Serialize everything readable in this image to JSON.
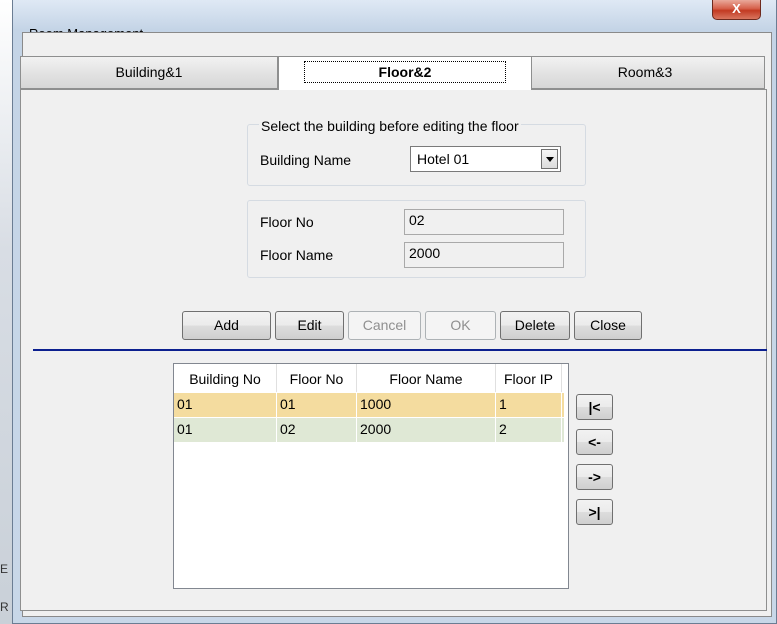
{
  "window": {
    "title": "Room Management",
    "close_label": "X"
  },
  "tabs": [
    {
      "label": "Building&1"
    },
    {
      "label": "Floor&2"
    },
    {
      "label": "Room&3"
    }
  ],
  "building_group": {
    "caption": "Select the building before editing the floor",
    "building_name_label": "Building Name",
    "building_name_value": "Hotel 01"
  },
  "floor_group": {
    "floor_no_label": "Floor No",
    "floor_no_value": "02",
    "floor_name_label": "Floor Name",
    "floor_name_value": "2000"
  },
  "buttons": {
    "add": "Add",
    "edit": "Edit",
    "cancel": "Cancel",
    "ok": "OK",
    "delete": "Delete",
    "close": "Close"
  },
  "grid": {
    "columns": [
      "Building No",
      "Floor No",
      "Floor Name",
      "Floor IP"
    ],
    "rows": [
      {
        "cells": [
          "01",
          "01",
          "1000",
          "1"
        ],
        "color": "#f4dc9f"
      },
      {
        "cells": [
          "01",
          "02",
          "2000",
          "2"
        ],
        "color": "#dfe8d5"
      }
    ]
  },
  "nav": {
    "first": "|<",
    "prev": "<-",
    "next": "->",
    "last": ">|"
  },
  "background_marks": [
    "E",
    "R"
  ]
}
